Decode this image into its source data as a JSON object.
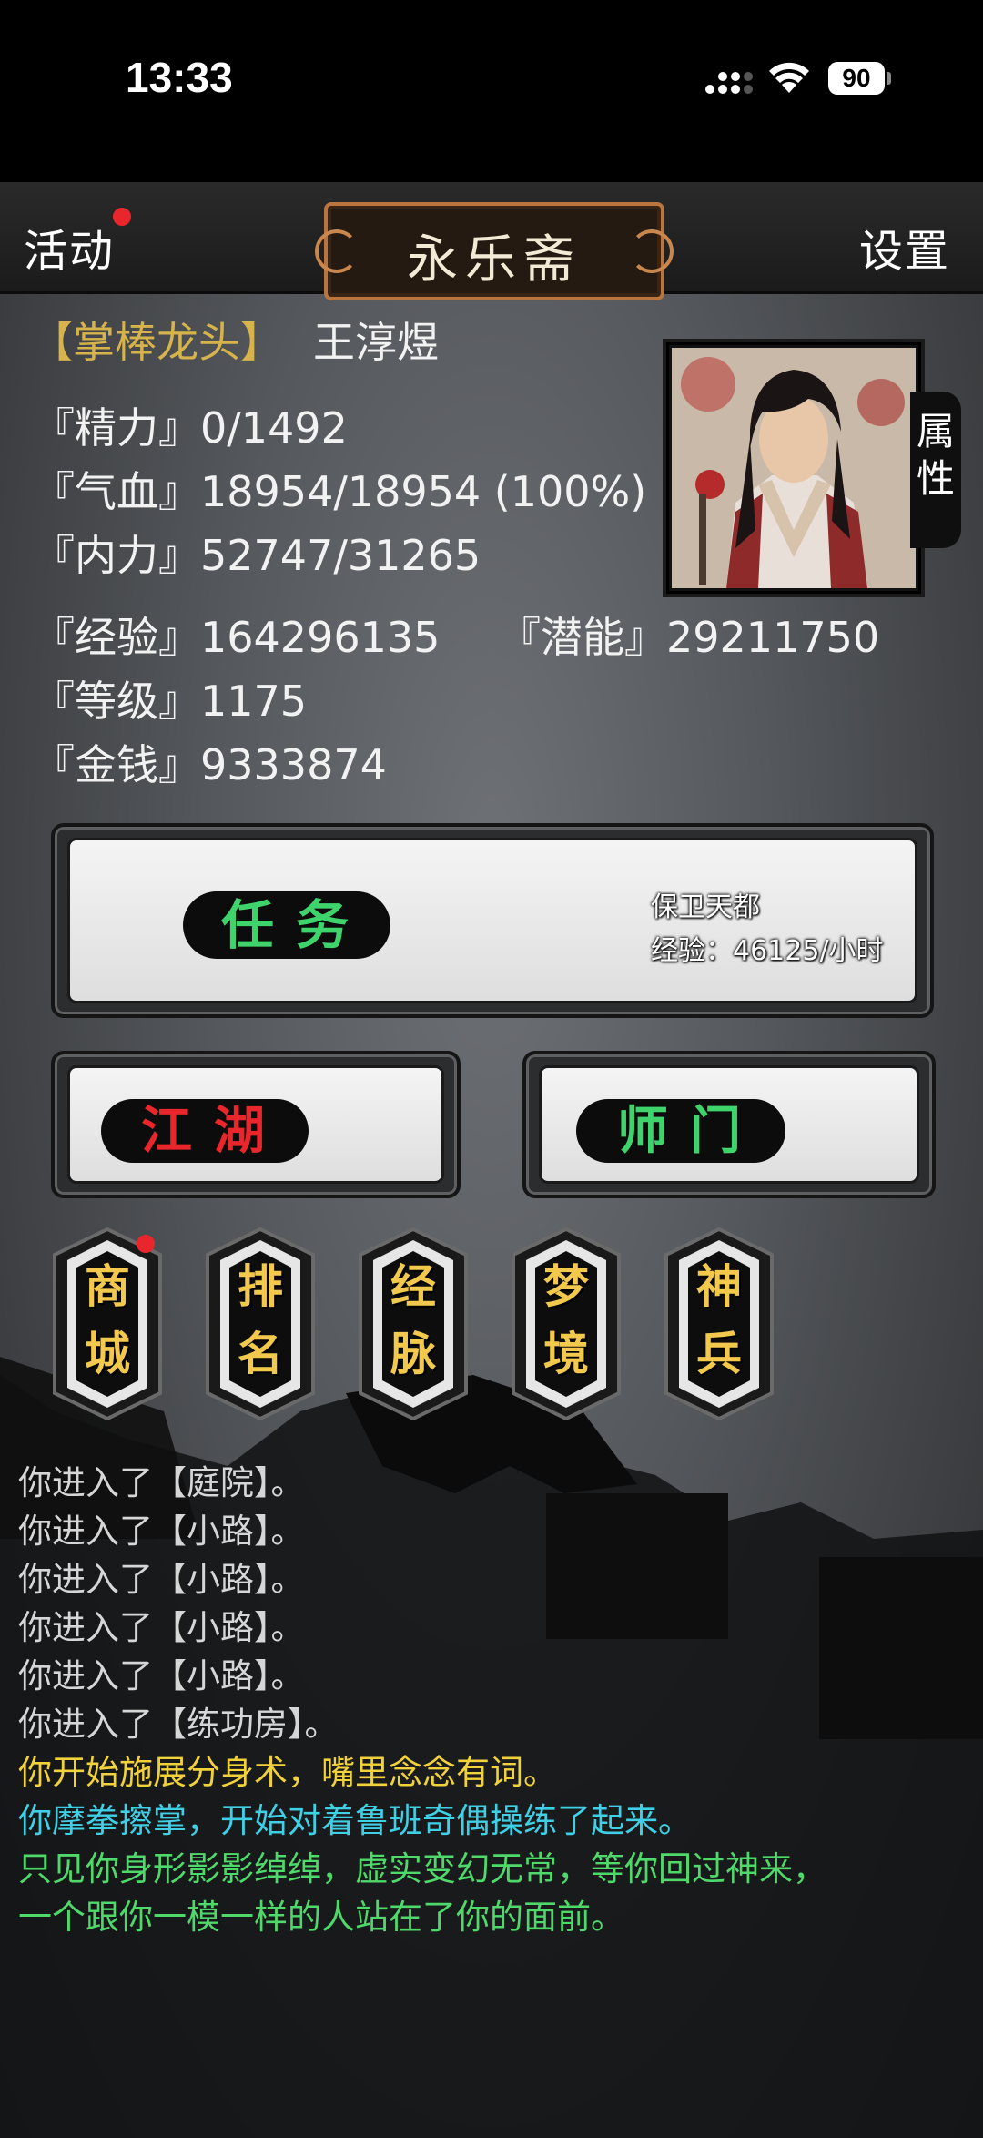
{
  "status_bar": {
    "time": "13:33",
    "battery": "90"
  },
  "header": {
    "activity_label": "活动",
    "title": "永乐斋",
    "settings_label": "设置"
  },
  "player": {
    "rank": "【掌棒龙头】",
    "name": "王淳煜",
    "stats": {
      "jingli": "『精力』0/1492",
      "qixue": "『气血』18954/18954 (100%)",
      "neili": "『内力』52747/31265",
      "jingyan": "『经验』164296135",
      "qianneng": "『潜能』29211750",
      "dengji": "『等级』1175",
      "jinqian": "『金钱』9333874"
    },
    "attributes_tab": [
      "属",
      "性"
    ]
  },
  "task_panel": {
    "label": "任务",
    "task_name": "保卫天都",
    "task_exp": "经验：46125/小时"
  },
  "buttons": {
    "jianghu": "江湖",
    "shimen": "师门"
  },
  "menu": [
    {
      "top": "商",
      "bottom": "城",
      "badge": true
    },
    {
      "top": "排",
      "bottom": "名",
      "badge": false
    },
    {
      "top": "经",
      "bottom": "脉",
      "badge": false
    },
    {
      "top": "梦",
      "bottom": "境",
      "badge": false
    },
    {
      "top": "神",
      "bottom": "兵",
      "badge": false
    }
  ],
  "log": [
    {
      "text": "你进入了【庭院】。",
      "color": "#d6d6d6"
    },
    {
      "text": "你进入了【小路】。",
      "color": "#d6d6d6"
    },
    {
      "text": "你进入了【小路】。",
      "color": "#d6d6d6"
    },
    {
      "text": "你进入了【小路】。",
      "color": "#d6d6d6"
    },
    {
      "text": "你进入了【小路】。",
      "color": "#d6d6d6"
    },
    {
      "text": "你进入了【练功房】。",
      "color": "#d6d6d6"
    },
    {
      "text": "你开始施展分身术，嘴里念念有词。",
      "color": "#f1d23a"
    },
    {
      "text": "你摩拳擦掌，开始对着鲁班奇偶操练了起来。",
      "color": "#3fd0e6"
    },
    {
      "text": "只见你身形影影绰绰，虚实变幻无常，等你回过神来，",
      "color": "#4fd96a"
    },
    {
      "text": "一个跟你一模一样的人站在了你的面前。",
      "color": "#4fd96a"
    }
  ],
  "colors": {
    "task_label": "#3fd46b",
    "jianghu": "#e8262b",
    "shimen": "#3fd46b",
    "rank": "#d7b34c"
  }
}
